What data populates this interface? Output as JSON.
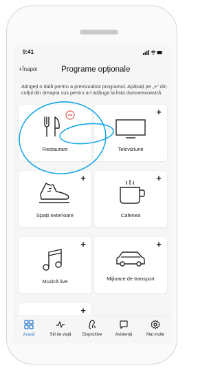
{
  "status": {
    "time": "9:41"
  },
  "header": {
    "back_label": "Înapoi",
    "title": "Programe opționale"
  },
  "instructions": "Atingeți o dală pentru a previzualiza programul. Apăsați pe „+” din colțul din dreapta sus pentru a-l adăuga la lista dumneavoastră.",
  "tiles": [
    {
      "label": "Restaurant",
      "icon": "fork-knife-icon",
      "action": "remove"
    },
    {
      "label": "Televiziune",
      "icon": "tv-icon",
      "action": "+"
    },
    {
      "label": "Spații exterioare",
      "icon": "shoe-icon",
      "action": "+"
    },
    {
      "label": "Cafenea",
      "icon": "coffee-cup-icon",
      "action": "+"
    },
    {
      "label": "Muzică live",
      "icon": "music-note-icon",
      "action": "+"
    },
    {
      "label": "Mijloace de transport",
      "icon": "car-icon",
      "action": "+"
    },
    {
      "label": "",
      "icon": "",
      "action": "+"
    }
  ],
  "tabbar": {
    "items": [
      {
        "label": "Acasă",
        "icon": "home-grid-icon",
        "active": true
      },
      {
        "label": "Stil de viață",
        "icon": "activity-icon",
        "active": false
      },
      {
        "label": "Dispozitive",
        "icon": "hearing-aid-icon",
        "active": false
      },
      {
        "label": "Asistență",
        "icon": "chat-icon",
        "active": false
      },
      {
        "label": "Mai multe",
        "icon": "gear-icon",
        "active": false
      }
    ]
  },
  "colors": {
    "accent": "#1a73c9",
    "annotation": "#1aa7e6",
    "remove": "#e05a5a"
  }
}
